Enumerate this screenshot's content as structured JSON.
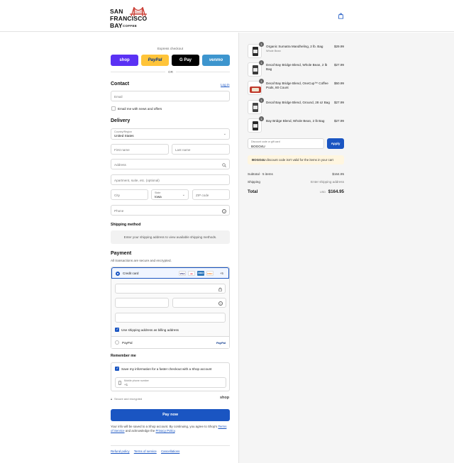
{
  "header": {
    "logo": {
      "line1": "SAN",
      "line2": "FRANCISCO",
      "line3": "BAY",
      "coffee": "COFFEE"
    }
  },
  "express": {
    "label": "Express checkout",
    "buttons": {
      "shop": "shop",
      "paypal": "PayPal",
      "gpay": "G Pay",
      "venmo": "venmo"
    },
    "or": "OR"
  },
  "contact": {
    "title": "Contact",
    "login": "Log in",
    "email_placeholder": "Email",
    "newsletter_label": "Email me with news and offers"
  },
  "delivery": {
    "title": "Delivery",
    "country_label": "Country/Region",
    "country_value": "United States",
    "first_name": "First name",
    "last_name": "Last name",
    "address": "Address",
    "apartment": "Apartment, suite, etc. (optional)",
    "city": "City",
    "state_label": "State",
    "state_value": "Iowa",
    "zip": "ZIP code",
    "phone": "Phone"
  },
  "shipping_method": {
    "title": "Shipping method",
    "message": "Enter your shipping address to view available shipping methods."
  },
  "payment": {
    "title": "Payment",
    "subtitle": "All transactions are secure and encrypted.",
    "credit_card": "Credit card",
    "more_cards": "+5",
    "card_icons": [
      "VISA",
      "MC",
      "AMEX",
      "DISC"
    ],
    "billing_label": "Use shipping address as billing address",
    "paypal": "PayPal",
    "paypal_logo": "PayPal"
  },
  "remember": {
    "title": "Remember me",
    "save_label": "Save my information for a faster checkout with a Shop account",
    "mobile_label": "Mobile phone number",
    "mobile_value": "+1",
    "secure": "Secure and encrypted",
    "shop_logo": "shop"
  },
  "pay_now": "Pay now",
  "legal": {
    "text1": "Your info will be saved to a Shop account. By continuing, you agree to Shop's",
    "terms": "Terms of Service",
    "text2": "and acknowledge the",
    "privacy": "Privacy Policy",
    "end": "."
  },
  "footer": {
    "refund": "Refund policy",
    "terms": "Terms of service",
    "cancel": "Cancellations"
  },
  "cart": {
    "items": [
      {
        "name": "Organic Sumatra Mandheling, 2 lb. Bag",
        "sub": "Whole Bean",
        "price": "$29.99",
        "qty": "1"
      },
      {
        "name": "Decaf Bay Bridge Blend, Whole Bean, 2 lb Bag",
        "sub": "",
        "price": "$27.99",
        "qty": "1"
      },
      {
        "name": "Decaf Bay Bridge Blend, OneCup™ Coffee Pods, 80 Count",
        "sub": "",
        "price": "$50.99",
        "qty": "1"
      },
      {
        "name": "Decaf Bay Bridge Blend, Ground, 28 oz Bag",
        "sub": "",
        "price": "$27.99",
        "qty": "1"
      },
      {
        "name": "Bay Bridge Blend, Whole Bean, 2 lb Bag",
        "sub": "",
        "price": "$27.99",
        "qty": "1"
      }
    ],
    "discount_label": "Discount code or gift card",
    "discount_value": "BOGO4U",
    "apply": "Apply",
    "error": "BOGO4U discount code isn't valid for the items in your cart",
    "subtotal_label": "Subtotal · 5 items",
    "subtotal": "$164.95",
    "shipping_label": "Shipping",
    "shipping_value": "Enter shipping address",
    "total_label": "Total",
    "currency": "USD",
    "total": "$164.95"
  },
  "colors": {
    "accent": "#1a55c2",
    "shop": "#5a31f4",
    "paypal": "#ffc439",
    "venmo": "#3d95ce"
  }
}
